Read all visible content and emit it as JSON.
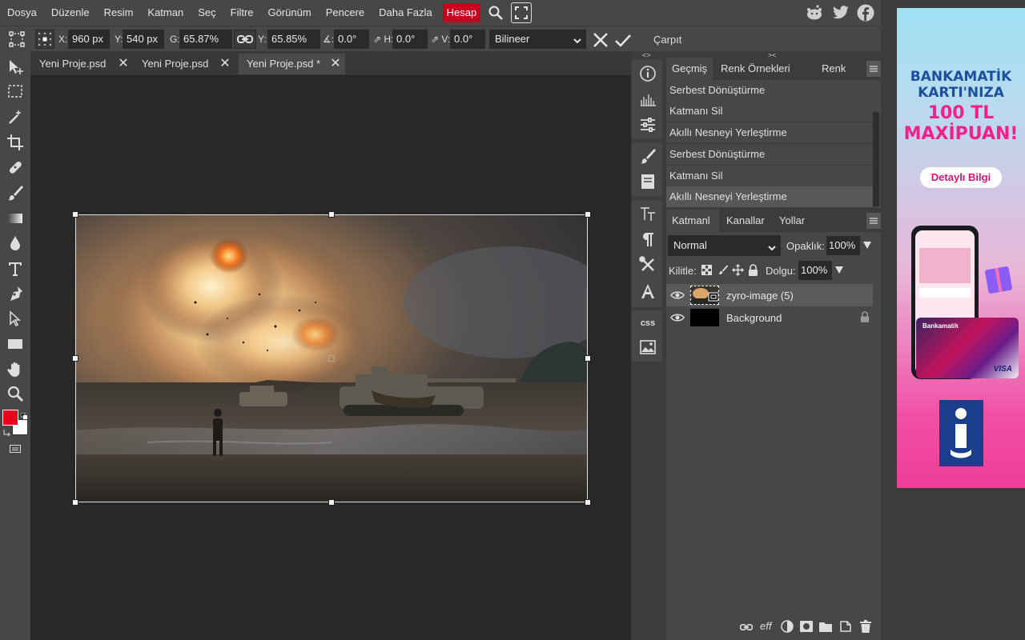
{
  "menu": {
    "items": [
      "Dosya",
      "Düzenle",
      "Resim",
      "Katman",
      "Seç",
      "Filtre",
      "Görünüm",
      "Pencere",
      "Daha Fazla"
    ],
    "account": "Hesap"
  },
  "options": {
    "x_label": "X:",
    "x_value": "960 px",
    "y_label": "Y:",
    "y_value": "540 px",
    "w_label": "G:",
    "w_value": "65.87%",
    "h_label": "Y:",
    "h_value": "65.85%",
    "angle_label": "∡:",
    "angle_value": "0.0°",
    "skew_h_label": "⇗ H:",
    "skew_h_value": "0.0°",
    "skew_v_label": "⇗ V:",
    "skew_v_value": "0.0°",
    "interpolation": "Bilineer",
    "warp_label": "Çarpıt"
  },
  "tabs": [
    {
      "label": "Yeni Proje.psd",
      "close": "✕"
    },
    {
      "label": "Yeni Proje.psd",
      "close": "✕"
    },
    {
      "label": "Yeni Proje.psd *",
      "close": "✕"
    }
  ],
  "history_panel": {
    "tabs": [
      "Geçmiş",
      "Renk Örnekleri",
      "Renk"
    ],
    "items": [
      "Serbest Dönüştürme",
      "Katmanı Sil",
      "Akıllı Nesneyi Yerleştirme",
      "Serbest Dönüştürme",
      "Katmanı Sil",
      "Akıllı Nesneyi Yerleştirme"
    ]
  },
  "layers_panel": {
    "tabs": [
      "Katmanl",
      "Kanallar",
      "Yollar"
    ],
    "blend_mode": "Normal",
    "opacity_label": "Opaklık:",
    "opacity_value": "100%",
    "lock_label": "Kilitle:",
    "fill_label": "Dolgu:",
    "fill_value": "100%",
    "layers": [
      {
        "name": "zyro-image (5)",
        "selected": true
      },
      {
        "name": "Background",
        "locked": true
      }
    ],
    "footer_text": "eff"
  },
  "strip": {
    "css_label": "css",
    "collapse_left": "<>",
    "collapse_right": "><"
  },
  "ad": {
    "line1": "BANKAMATİK",
    "line2": "KARTI'NIZA",
    "line3": "100 TL",
    "line4": "MAXİPUAN!",
    "button": "Detaylı Bilgi",
    "card_brand": "Bankamatik",
    "card_network": "VISA"
  },
  "colors": {
    "foreground": "#e8001c",
    "background": "#ffffff",
    "account_bg": "#c8001e"
  }
}
